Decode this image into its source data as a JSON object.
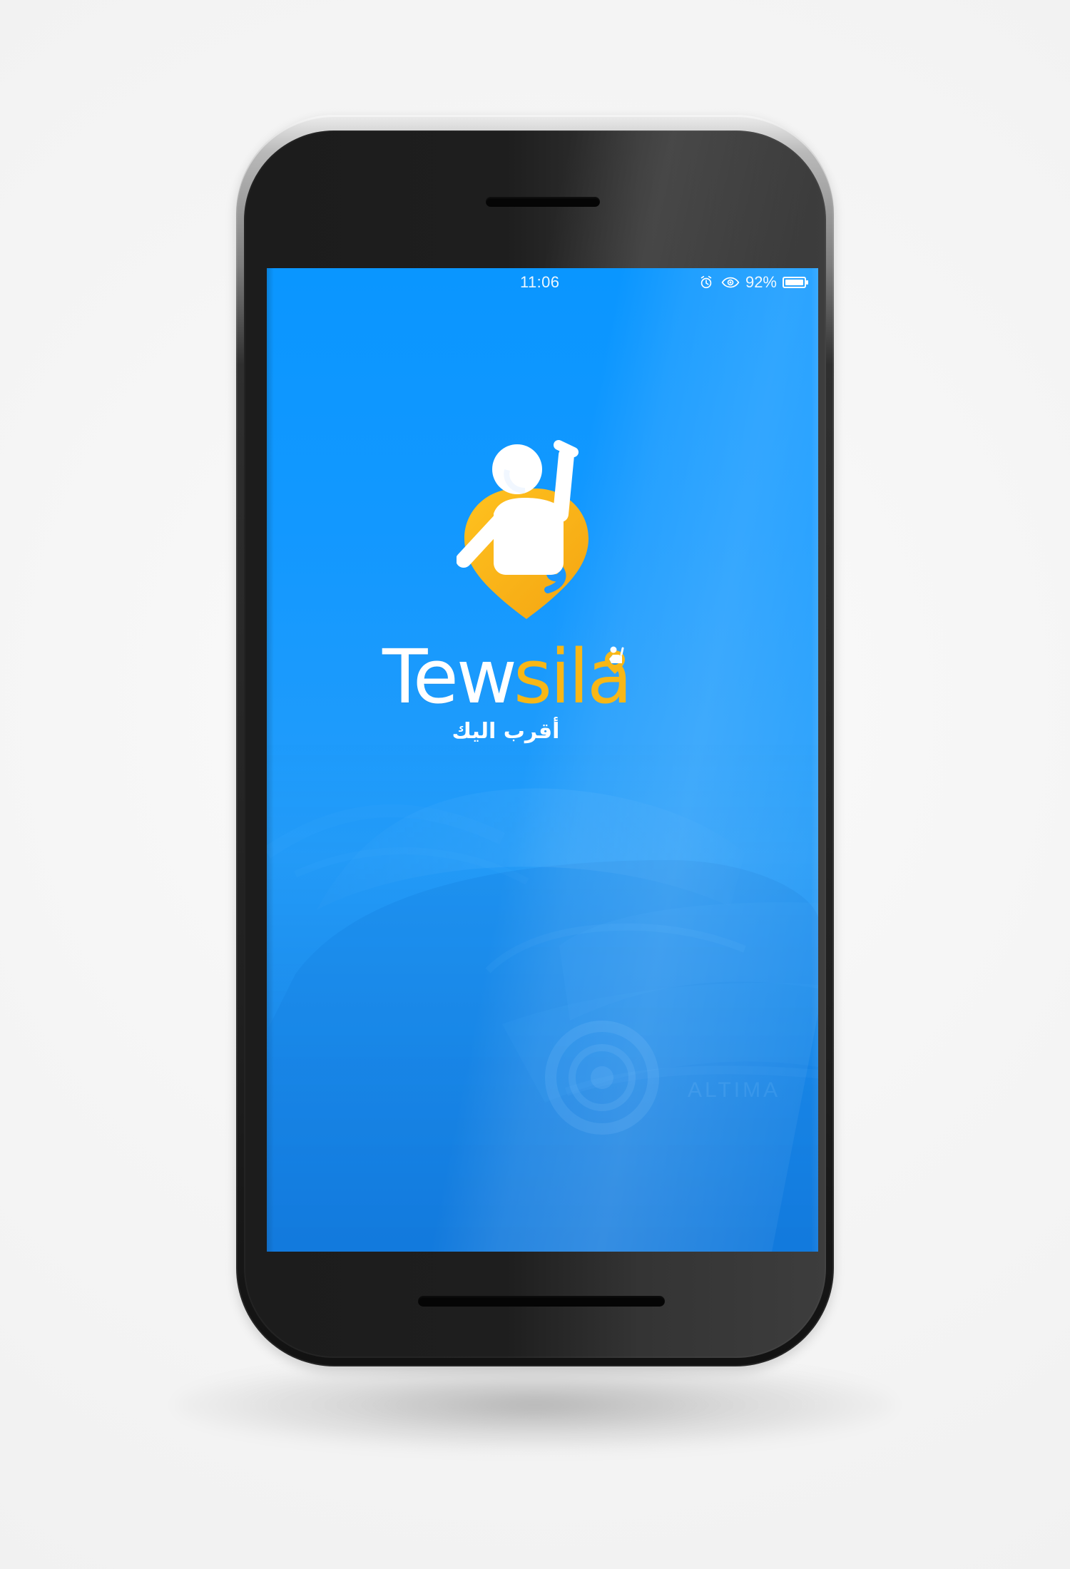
{
  "status_bar": {
    "time": "11:06",
    "battery_percent": "92%"
  },
  "app": {
    "brand_part_1": "Tew",
    "brand_part_2": "sila",
    "tagline": "أقرب اليك"
  },
  "colors": {
    "screen_blue": "#1496ff",
    "brand_yellow": "#f8b716",
    "white": "#ffffff",
    "phone_black": "#1e1e1e"
  },
  "icons": {
    "status_alarm": "alarm-icon",
    "status_eye": "eye-icon",
    "status_battery": "battery-icon",
    "logo": "person-location-pin-icon"
  }
}
